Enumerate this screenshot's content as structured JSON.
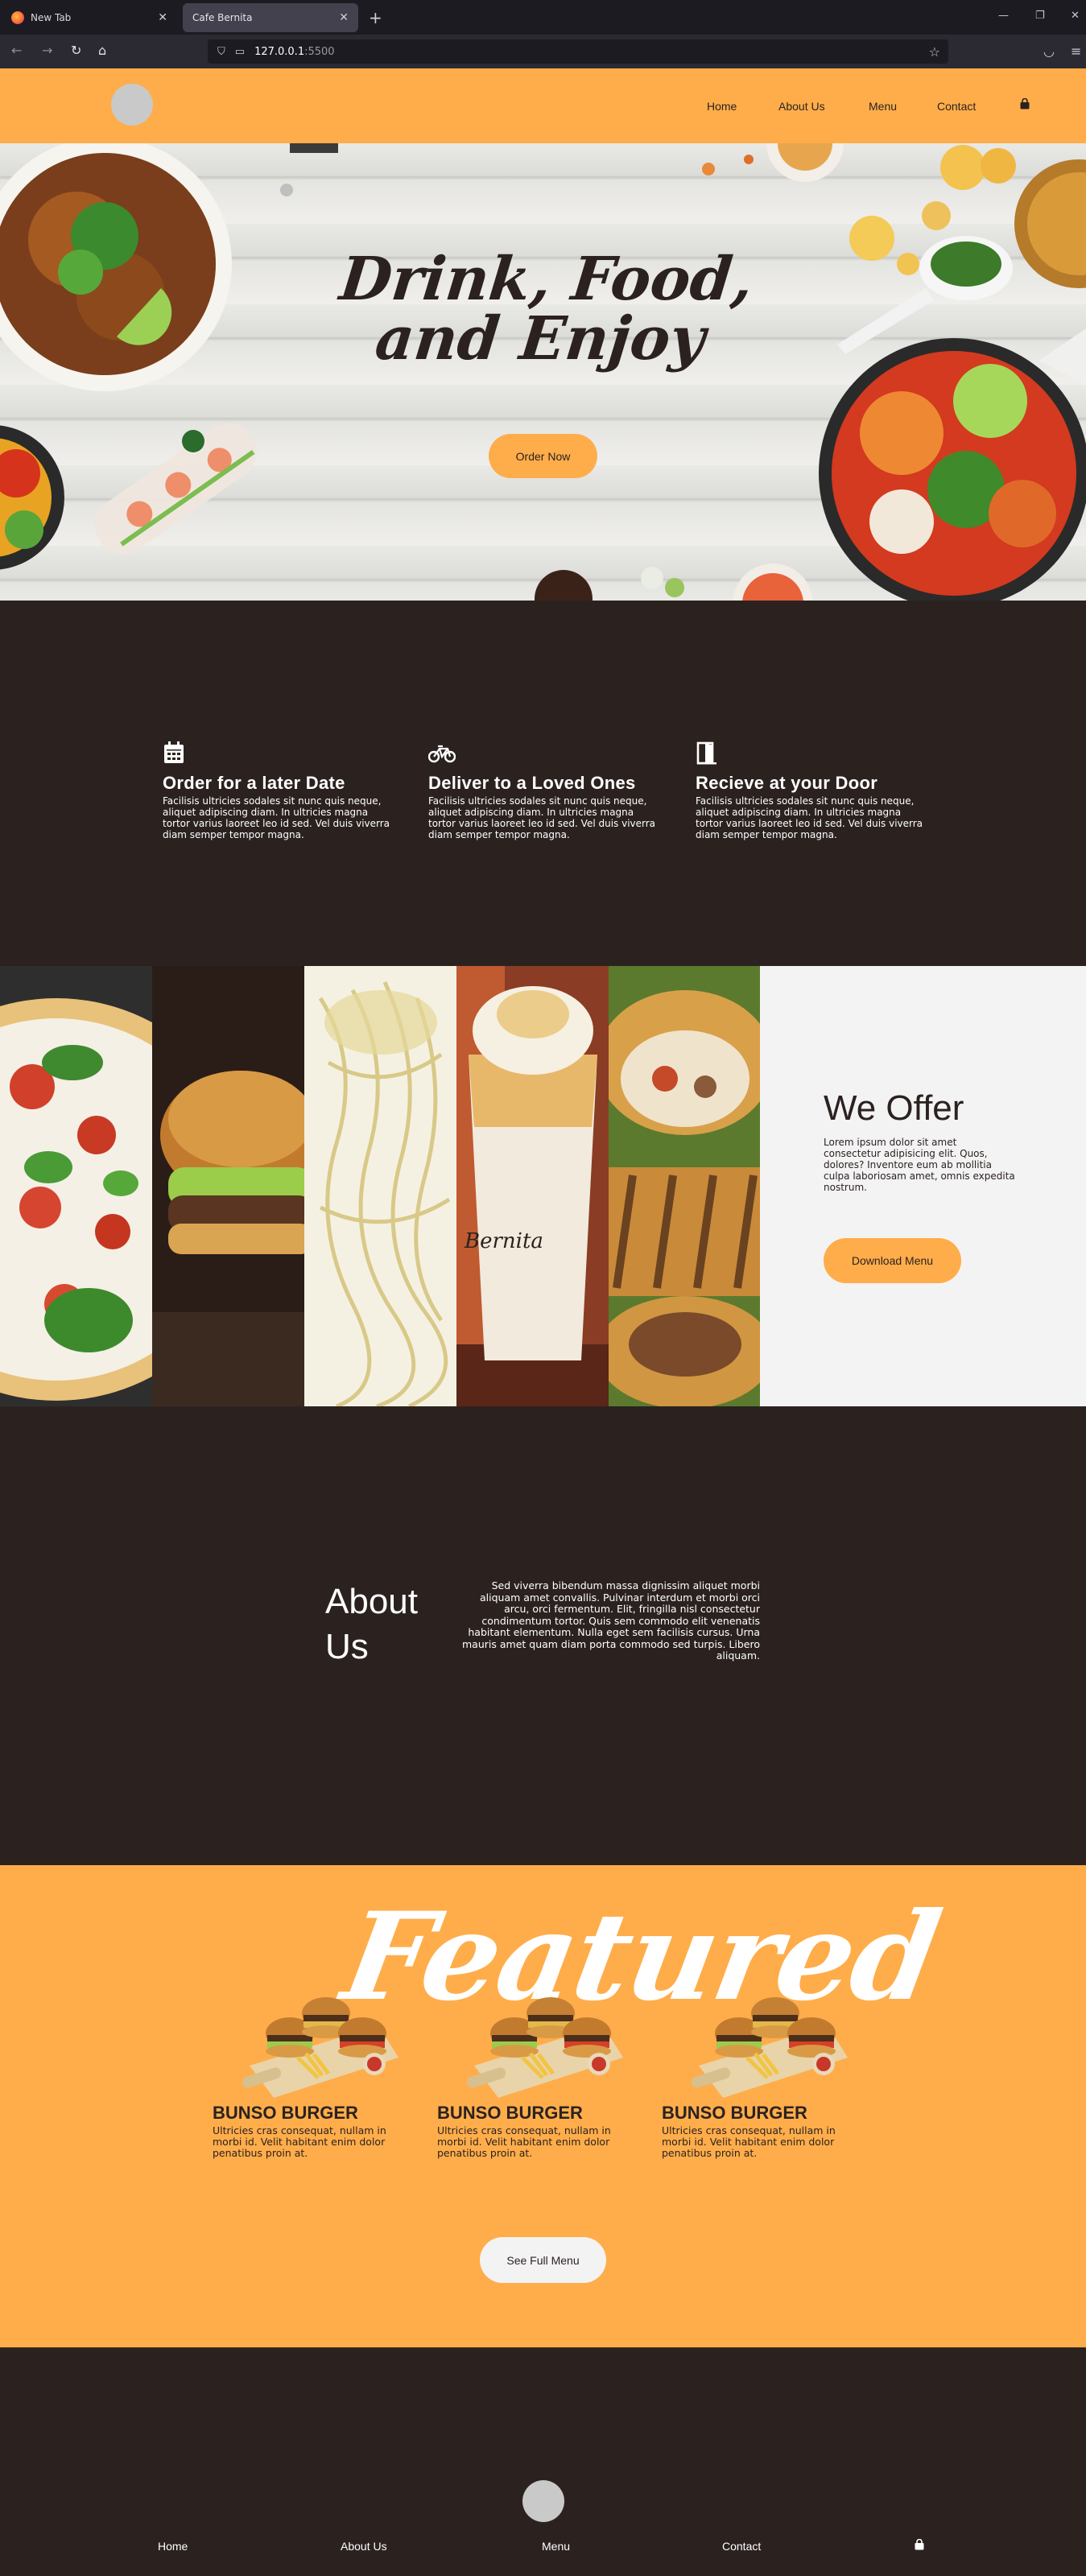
{
  "browser": {
    "tabs": [
      {
        "label": "New Tab"
      },
      {
        "label": "Cafe Bernita"
      }
    ],
    "new_tab_glyph": "+",
    "url_host": "127.0.0.1",
    "url_port": ":5500",
    "window_controls": [
      "—",
      "❐",
      "✕"
    ]
  },
  "header": {
    "nav": [
      "Home",
      "About Us",
      "Menu",
      "Contact"
    ]
  },
  "hero": {
    "headline": "Drink, Food, and Enjoy",
    "cta": "Order Now"
  },
  "services": [
    {
      "icon": "calendar-icon",
      "title": "Order for a later Date",
      "body": "Facilisis ultricies sodales sit nunc quis neque, aliquet adipiscing diam. In ultricies magna tortor varius laoreet leo id sed. Vel duis viverra diam semper tempor magna."
    },
    {
      "icon": "bicycle-icon",
      "title": "Deliver to a Loved Ones",
      "body": "Facilisis ultricies sodales sit nunc quis neque, aliquet adipiscing diam. In ultricies magna tortor varius laoreet leo id sed. Vel duis viverra diam semper tempor magna."
    },
    {
      "icon": "door-icon",
      "title": "Recieve at your Door",
      "body": "Facilisis ultricies sodales sit nunc quis neque, aliquet adipiscing diam. In ultricies magna tortor varius laoreet leo id sed. Vel duis viverra diam semper tempor magna."
    }
  ],
  "offer": {
    "title": "We Offer",
    "body": "Lorem ipsum dolor sit amet consectetur adipisicing elit. Quos, dolores? Inventore eum ab mollitia culpa laboriosam amet, omnis expedita nostrum.",
    "cta": "Download Menu",
    "cup_text": "Bernita"
  },
  "about": {
    "title": "About Us",
    "body": "Sed viverra bibendum massa dignissim aliquet morbi aliquam amet convallis. Pulvinar interdum et morbi orci arcu, orci fermentum. Elit, fringilla nisl consectetur condimentum tortor. Quis sem commodo elit venenatis habitant elementum. Nulla eget sem facilisis cursus. Urna mauris amet quam diam porta commodo sed turpis. Libero aliquam."
  },
  "featured": {
    "title": "Featured",
    "items": [
      {
        "name": "BUNSO BURGER",
        "desc": "Ultricies cras consequat, nullam in morbi id. Velit habitant enim dolor penatibus proin at."
      },
      {
        "name": "BUNSO BURGER",
        "desc": "Ultricies cras consequat, nullam in morbi id. Velit habitant enim dolor penatibus proin at."
      },
      {
        "name": "BUNSO BURGER",
        "desc": "Ultricies cras consequat, nullam in morbi id. Velit habitant enim dolor penatibus proin at."
      }
    ],
    "cta": "See Full Menu"
  },
  "footer": {
    "nav": [
      "Home",
      "About Us",
      "Menu",
      "Contact"
    ]
  },
  "colors": {
    "accent": "#ffad4a",
    "dark": "#2b2220",
    "light": "#f3f3f3"
  }
}
